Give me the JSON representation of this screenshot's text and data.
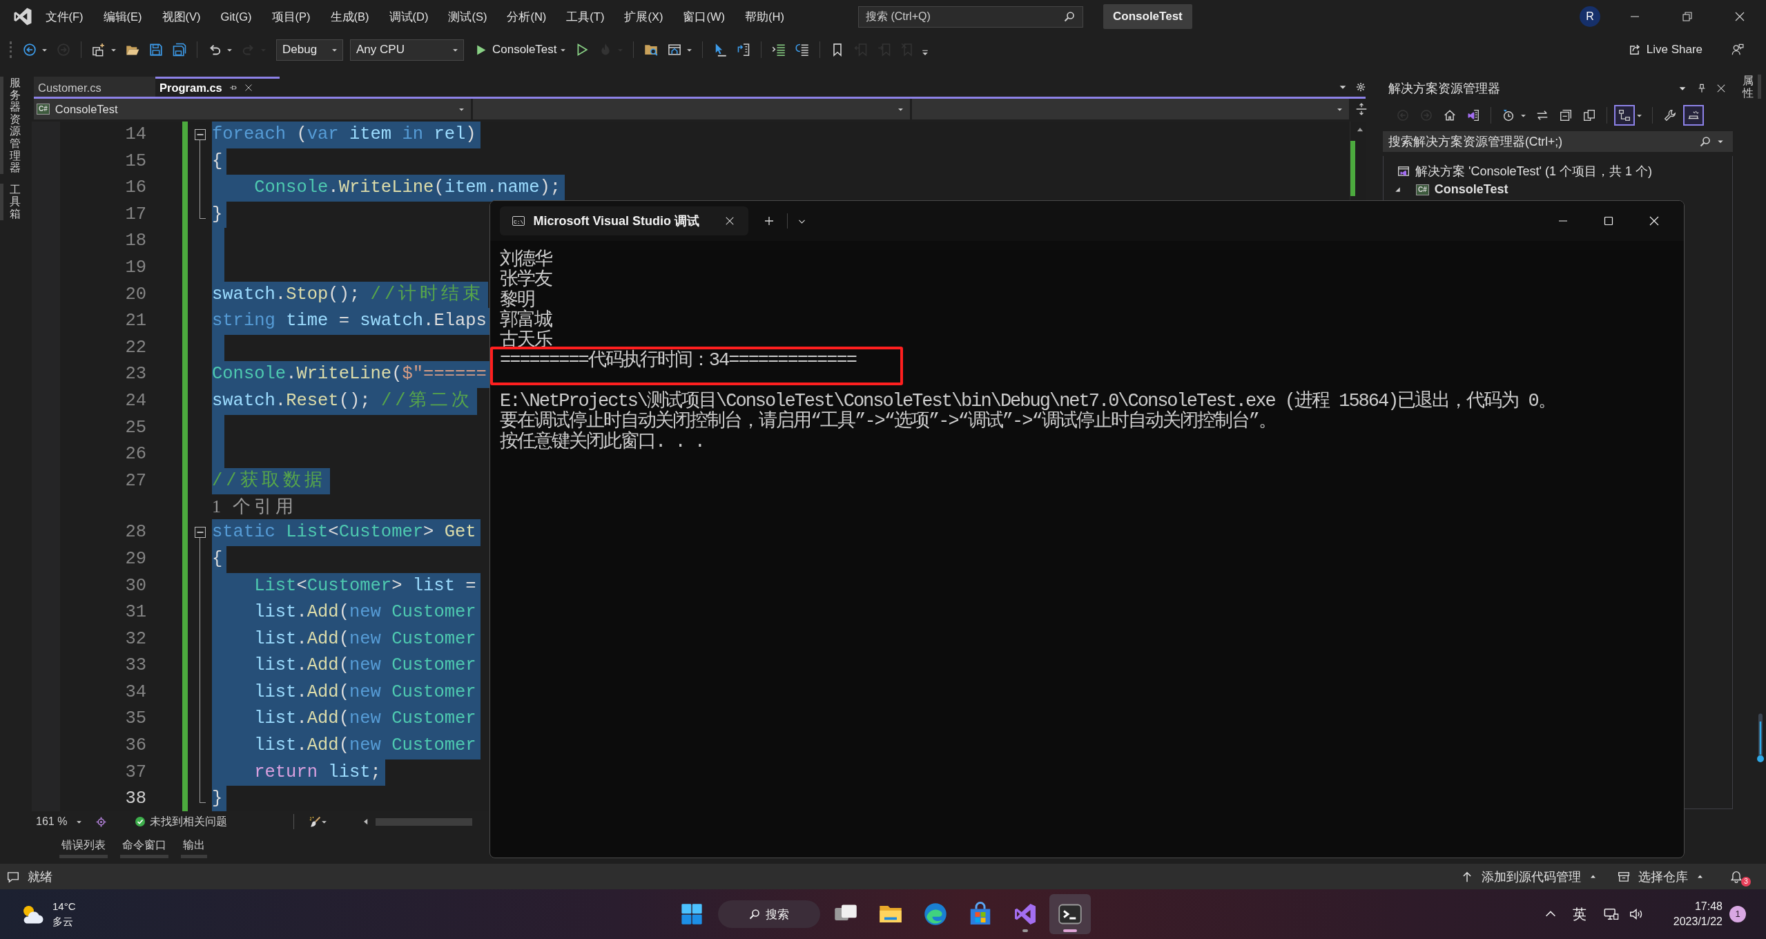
{
  "menubar": {
    "items": [
      "文件(F)",
      "编辑(E)",
      "视图(V)",
      "Git(G)",
      "项目(P)",
      "生成(B)",
      "调试(D)",
      "测试(S)",
      "分析(N)",
      "工具(T)",
      "扩展(X)",
      "窗口(W)",
      "帮助(H)"
    ],
    "search": {
      "placeholder": "搜索 (Ctrl+Q)"
    },
    "solution_name": "ConsoleTest",
    "account_initial": "R"
  },
  "toolbar": {
    "items": [
      {
        "kind": "icon",
        "disabled": false,
        "split": true
      },
      {
        "kind": "icon",
        "disabled": true,
        "split": false
      },
      {
        "kind": "separator"
      },
      {
        "kind": "icon",
        "disabled": false,
        "split": true
      },
      {
        "kind": "icon",
        "disabled": false,
        "split": false
      },
      {
        "kind": "icon",
        "disabled": false,
        "split": false
      },
      {
        "kind": "icon",
        "disabled": false,
        "split": false
      },
      {
        "kind": "separator"
      },
      {
        "kind": "icon",
        "disabled": false,
        "split": true
      },
      {
        "kind": "icon",
        "disabled": true,
        "split": true
      },
      {
        "kind": "dropdown",
        "value": "Debug"
      },
      {
        "kind": "dropdown",
        "value": "Any CPU"
      },
      {
        "kind": "run",
        "label": "ConsoleTest"
      },
      {
        "kind": "icon",
        "disabled": false,
        "split": false
      },
      {
        "kind": "icon",
        "disabled": true,
        "split": true
      },
      {
        "kind": "separator"
      },
      {
        "kind": "icon",
        "disabled": false,
        "split": false
      },
      {
        "kind": "icon",
        "disabled": false,
        "split": true
      },
      {
        "kind": "separator"
      },
      {
        "kind": "icon",
        "disabled": false,
        "split": false
      },
      {
        "kind": "icon",
        "disabled": false,
        "split": false
      },
      {
        "kind": "separator"
      },
      {
        "kind": "icon",
        "disabled": false,
        "split": false
      },
      {
        "kind": "icon",
        "disabled": false,
        "split": false
      },
      {
        "kind": "separator"
      },
      {
        "kind": "icon",
        "disabled": false,
        "split": false
      },
      {
        "kind": "icon",
        "disabled": true,
        "split": false
      },
      {
        "kind": "icon",
        "disabled": true,
        "split": false
      },
      {
        "kind": "icon",
        "disabled": true,
        "split": false
      },
      {
        "kind": "overflow"
      }
    ],
    "live_share": "Live Share"
  },
  "left_dock": [
    "服务器资源管理器",
    "工具箱"
  ],
  "right_dock": [
    "属性"
  ],
  "document_tabs": [
    {
      "label": "Customer.cs",
      "selected": false
    },
    {
      "label": "Program.cs",
      "selected": true
    }
  ],
  "navigation_bar": {
    "project": {
      "badge": "C#",
      "label": "ConsoleTest"
    }
  },
  "editor": {
    "lines": [
      {
        "kind": "code",
        "number": "14",
        "selected": true,
        "changed": true,
        "current": false,
        "expanded": true,
        "tokens": [
          {
            "kind": "keyword",
            "text": "foreach"
          },
          {
            "kind": "plain",
            "text": " ("
          },
          {
            "kind": "keyword",
            "text": "var"
          },
          {
            "kind": "variable",
            "text": " item"
          },
          {
            "kind": "keyword",
            "text": " in"
          },
          {
            "kind": "variable",
            "text": " rel"
          },
          {
            "kind": "plain",
            "text": ")"
          }
        ]
      },
      {
        "kind": "code",
        "number": "15",
        "selected": true,
        "changed": true,
        "current": false,
        "tokens": [
          {
            "kind": "plain",
            "text": "{"
          }
        ]
      },
      {
        "kind": "code",
        "number": "16",
        "selected": true,
        "changed": true,
        "current": false,
        "tokens": [
          {
            "kind": "type",
            "text": "    Console"
          },
          {
            "kind": "plain",
            "text": "."
          },
          {
            "kind": "method",
            "text": "WriteLine"
          },
          {
            "kind": "plain",
            "text": "("
          },
          {
            "kind": "variable",
            "text": "item"
          },
          {
            "kind": "plain",
            "text": "."
          },
          {
            "kind": "variable",
            "text": "name"
          },
          {
            "kind": "plain",
            "text": ");"
          }
        ]
      },
      {
        "kind": "code",
        "number": "17",
        "selected": true,
        "changed": true,
        "current": false,
        "block_end": true,
        "tokens": [
          {
            "kind": "plain",
            "text": "}"
          }
        ]
      },
      {
        "kind": "code",
        "number": "18",
        "selected": true,
        "changed": true,
        "current": false
      },
      {
        "kind": "code",
        "number": "19",
        "selected": true,
        "changed": true,
        "current": false
      },
      {
        "kind": "code",
        "number": "20",
        "selected": true,
        "changed": true,
        "current": false,
        "tokens": [
          {
            "kind": "variable",
            "text": "swatch"
          },
          {
            "kind": "plain",
            "text": "."
          },
          {
            "kind": "method",
            "text": "Stop"
          },
          {
            "kind": "plain",
            "text": "(); "
          },
          {
            "kind": "comment",
            "text": "//计时结束"
          }
        ]
      },
      {
        "kind": "code",
        "number": "21",
        "selected": true,
        "changed": true,
        "current": false,
        "tokens": [
          {
            "kind": "keyword",
            "text": "string"
          },
          {
            "kind": "variable",
            "text": " time"
          },
          {
            "kind": "plain",
            "text": " = "
          },
          {
            "kind": "variable",
            "text": "swatch"
          },
          {
            "kind": "plain",
            "text": ".Elaps"
          }
        ]
      },
      {
        "kind": "code",
        "number": "22",
        "selected": true,
        "changed": true,
        "current": false
      },
      {
        "kind": "code",
        "number": "23",
        "selected": true,
        "changed": true,
        "current": false,
        "tokens": [
          {
            "kind": "type",
            "text": "Console"
          },
          {
            "kind": "plain",
            "text": "."
          },
          {
            "kind": "method",
            "text": "WriteLine"
          },
          {
            "kind": "plain",
            "text": "("
          },
          {
            "kind": "string",
            "text": "$\"======"
          }
        ]
      },
      {
        "kind": "code",
        "number": "24",
        "selected": true,
        "changed": true,
        "current": false,
        "tokens": [
          {
            "kind": "variable",
            "text": "swatch"
          },
          {
            "kind": "plain",
            "text": "."
          },
          {
            "kind": "method",
            "text": "Reset"
          },
          {
            "kind": "plain",
            "text": "(); "
          },
          {
            "kind": "comment",
            "text": "//第二次"
          }
        ]
      },
      {
        "kind": "code",
        "number": "25",
        "selected": true,
        "changed": true,
        "current": false
      },
      {
        "kind": "code",
        "number": "26",
        "selected": true,
        "changed": true,
        "current": false
      },
      {
        "kind": "code",
        "number": "27",
        "selected": true,
        "changed": true,
        "current": false,
        "tokens": [
          {
            "kind": "comment",
            "text": "//获取数据"
          }
        ]
      },
      {
        "kind": "codelens",
        "text": "1 个引用",
        "changed": true
      },
      {
        "kind": "code",
        "number": "28",
        "selected": true,
        "changed": true,
        "current": false,
        "expanded": true,
        "tokens": [
          {
            "kind": "keyword",
            "text": "static"
          },
          {
            "kind": "type",
            "text": " List"
          },
          {
            "kind": "plain",
            "text": "<"
          },
          {
            "kind": "type",
            "text": "Customer"
          },
          {
            "kind": "plain",
            "text": "> "
          },
          {
            "kind": "method",
            "text": "Get"
          }
        ]
      },
      {
        "kind": "code",
        "number": "29",
        "selected": true,
        "changed": true,
        "current": false,
        "tokens": [
          {
            "kind": "plain",
            "text": "{"
          }
        ]
      },
      {
        "kind": "code",
        "number": "30",
        "selected": true,
        "changed": true,
        "current": false,
        "tokens": [
          {
            "kind": "type",
            "text": "    List"
          },
          {
            "kind": "plain",
            "text": "<"
          },
          {
            "kind": "type",
            "text": "Customer"
          },
          {
            "kind": "plain",
            "text": "> "
          },
          {
            "kind": "variable",
            "text": "list"
          },
          {
            "kind": "plain",
            "text": " ="
          }
        ]
      },
      {
        "kind": "code",
        "number": "31",
        "selected": true,
        "changed": true,
        "current": false,
        "tokens": [
          {
            "kind": "variable",
            "text": "    list"
          },
          {
            "kind": "plain",
            "text": "."
          },
          {
            "kind": "method",
            "text": "Add"
          },
          {
            "kind": "plain",
            "text": "("
          },
          {
            "kind": "keyword",
            "text": "new"
          },
          {
            "kind": "type",
            "text": " Customer"
          }
        ]
      },
      {
        "kind": "code",
        "number": "32",
        "selected": true,
        "changed": true,
        "current": false,
        "tokens": [
          {
            "kind": "variable",
            "text": "    list"
          },
          {
            "kind": "plain",
            "text": "."
          },
          {
            "kind": "method",
            "text": "Add"
          },
          {
            "kind": "plain",
            "text": "("
          },
          {
            "kind": "keyword",
            "text": "new"
          },
          {
            "kind": "type",
            "text": " Customer"
          }
        ]
      },
      {
        "kind": "code",
        "number": "33",
        "selected": true,
        "changed": true,
        "current": false,
        "tokens": [
          {
            "kind": "variable",
            "text": "    list"
          },
          {
            "kind": "plain",
            "text": "."
          },
          {
            "kind": "method",
            "text": "Add"
          },
          {
            "kind": "plain",
            "text": "("
          },
          {
            "kind": "keyword",
            "text": "new"
          },
          {
            "kind": "type",
            "text": " Customer"
          }
        ]
      },
      {
        "kind": "code",
        "number": "34",
        "selected": true,
        "changed": true,
        "current": false,
        "tokens": [
          {
            "kind": "variable",
            "text": "    list"
          },
          {
            "kind": "plain",
            "text": "."
          },
          {
            "kind": "method",
            "text": "Add"
          },
          {
            "kind": "plain",
            "text": "("
          },
          {
            "kind": "keyword",
            "text": "new"
          },
          {
            "kind": "type",
            "text": " Customer"
          }
        ]
      },
      {
        "kind": "code",
        "number": "35",
        "selected": true,
        "changed": true,
        "current": false,
        "tokens": [
          {
            "kind": "variable",
            "text": "    list"
          },
          {
            "kind": "plain",
            "text": "."
          },
          {
            "kind": "method",
            "text": "Add"
          },
          {
            "kind": "plain",
            "text": "("
          },
          {
            "kind": "keyword",
            "text": "new"
          },
          {
            "kind": "type",
            "text": " Customer"
          }
        ]
      },
      {
        "kind": "code",
        "number": "36",
        "selected": true,
        "changed": true,
        "current": false,
        "tokens": [
          {
            "kind": "variable",
            "text": "    list"
          },
          {
            "kind": "plain",
            "text": "."
          },
          {
            "kind": "method",
            "text": "Add"
          },
          {
            "kind": "plain",
            "text": "("
          },
          {
            "kind": "keyword",
            "text": "new"
          },
          {
            "kind": "type",
            "text": " Customer"
          }
        ]
      },
      {
        "kind": "code",
        "number": "37",
        "selected": true,
        "changed": true,
        "current": false,
        "tokens": [
          {
            "kind": "control",
            "text": "    return"
          },
          {
            "kind": "variable",
            "text": " list"
          },
          {
            "kind": "plain",
            "text": ";"
          }
        ]
      },
      {
        "kind": "code",
        "number": "38",
        "selected": true,
        "changed": true,
        "current": true,
        "block_end": true,
        "tokens": [
          {
            "kind": "plain",
            "text": "}"
          }
        ]
      }
    ]
  },
  "editor_status": {
    "zoom": "161 %",
    "issues": "未找到相关问题"
  },
  "bottom_tabs": [
    "错误列表",
    "命令窗口",
    "输出"
  ],
  "solution_explorer": {
    "title": "解决方案资源管理器",
    "toolbar": [
      {
        "kind": "icon",
        "disabled": true,
        "on": false,
        "split": false
      },
      {
        "kind": "icon",
        "disabled": true,
        "on": false,
        "split": false
      },
      {
        "kind": "icon",
        "disabled": false,
        "on": false,
        "split": false
      },
      {
        "kind": "icon",
        "disabled": false,
        "on": false,
        "split": false
      },
      {
        "kind": "separator"
      },
      {
        "kind": "icon",
        "disabled": false,
        "on": false,
        "split": true
      },
      {
        "kind": "icon",
        "disabled": false,
        "on": false,
        "split": false
      },
      {
        "kind": "icon",
        "disabled": false,
        "on": false,
        "split": false
      },
      {
        "kind": "icon",
        "disabled": false,
        "on": false,
        "split": false
      },
      {
        "kind": "separator"
      },
      {
        "kind": "icon",
        "disabled": false,
        "on": true,
        "split": true
      },
      {
        "kind": "separator"
      },
      {
        "kind": "icon",
        "disabled": false,
        "on": false,
        "split": false
      },
      {
        "kind": "icon",
        "disabled": false,
        "on": true,
        "split": false
      }
    ],
    "search": {
      "placeholder": "搜索解决方案资源管理器(Ctrl+;)"
    },
    "tree": [
      {
        "kind": "solution",
        "label": "解决方案 'ConsoleTest' (1 个项目，共 1 个)",
        "children": [
          {
            "kind": "project",
            "badge": "C#",
            "label": "ConsoleTest",
            "expanded": true
          }
        ]
      }
    ]
  },
  "console": {
    "tab_icon_text": "C:\\",
    "tab_title": "Microsoft Visual Studio 调试",
    "output": [
      [
        {
          "text": "刘德华",
          "highlighted": false
        },
        {
          "text": "张学友",
          "highlighted": false
        },
        {
          "text": "黎明",
          "highlighted": false
        },
        {
          "text": "郭富城",
          "highlighted": false
        },
        {
          "text": "古天乐",
          "highlighted": false
        },
        {
          "text": "=========代码执行时间：34=============",
          "highlighted": true
        }
      ],
      [
        {
          "text": "E:\\NetProjects\\测试项目\\ConsoleTest\\ConsoleTest\\bin\\Debug\\net7.0\\ConsoleTest.exe (进程 15864)已退出，代码为 0。",
          "highlighted": false
        },
        {
          "text": "要在调试停止时自动关闭控制台，请启用“工具”->“选项”->“调试”->“调试停止时自动关闭控制台”。",
          "highlighted": false
        },
        {
          "text": "按任意键关闭此窗口. . .",
          "highlighted": false
        }
      ]
    ]
  },
  "status_bar": {
    "message": "就绪",
    "source_control": "添加到源代码管理",
    "repository": "选择仓库",
    "notifications": "3"
  },
  "taskbar": {
    "weather": {
      "temperature": "14°C",
      "condition": "多云"
    },
    "search": "搜索",
    "apps": [
      {
        "running": false,
        "active": false
      },
      {
        "running": false,
        "active": false
      },
      {
        "running": false,
        "active": false
      },
      {
        "running": false,
        "active": false
      },
      {
        "running": true,
        "active": false
      },
      {
        "running": true,
        "active": true
      }
    ],
    "input_method": "英",
    "time": "17:48",
    "date": "2023/1/22",
    "notifications": "1"
  }
}
